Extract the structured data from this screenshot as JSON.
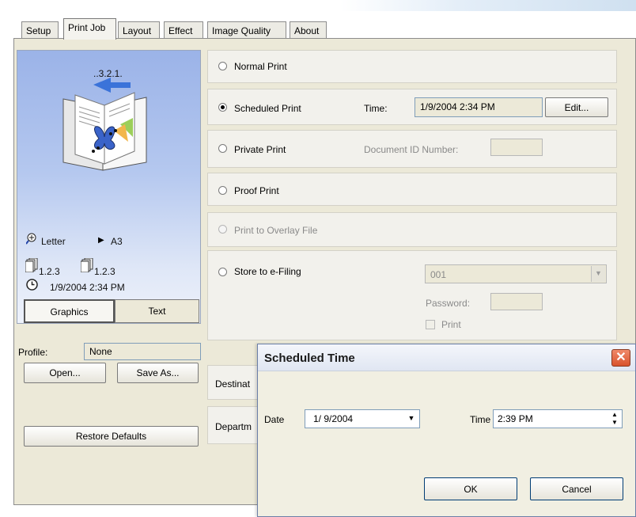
{
  "tabs": [
    "Setup",
    "Print Job",
    "Layout",
    "Effect",
    "Image Quality",
    "About"
  ],
  "preview": {
    "page_order": "..3.2.1.",
    "paper_size": "Letter",
    "output_size": "A3",
    "copies_left": "1.2.3",
    "copies_right": "1.2.3",
    "scheduled": "1/9/2004 2:34 PM",
    "view_graphics": "Graphics",
    "view_text": "Text"
  },
  "profile": {
    "label": "Profile:",
    "value": "None"
  },
  "buttons": {
    "open": "Open...",
    "save_as": "Save As...",
    "restore": "Restore Defaults"
  },
  "options": {
    "normal": "Normal Print",
    "scheduled": "Scheduled Print",
    "time_label": "Time:",
    "time_value": "1/9/2004 2:34 PM",
    "edit": "Edit...",
    "private": "Private Print",
    "doc_id": "Document ID Number:",
    "proof": "Proof Print",
    "overlay": "Print to Overlay File",
    "store": "Store to e-Filing",
    "efiling_box": "001",
    "password": "Password:",
    "print": "Print"
  },
  "partial": {
    "destination": "Destinat",
    "department": "Departm"
  },
  "dialog": {
    "title": "Scheduled Time",
    "date_label": "Date",
    "date_value": "1/ 9/2004",
    "time_label": "Time",
    "time_value": "2:39 PM",
    "ok": "OK",
    "cancel": "Cancel"
  },
  "colors": {
    "accent_arrow": "#3b73d9",
    "close_button": "#d9532c",
    "selected_radio": "#000000"
  }
}
